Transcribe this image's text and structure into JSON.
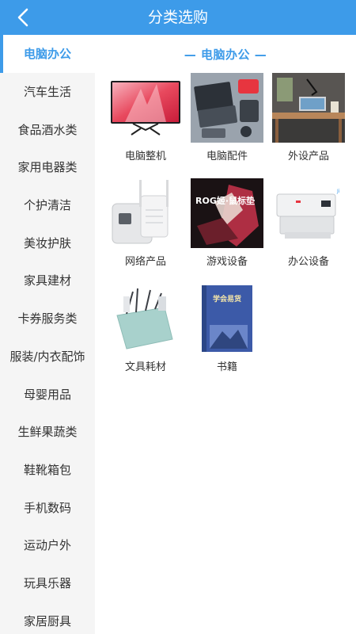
{
  "header": {
    "title": "分类选购",
    "back_icon": "chevron-left-icon"
  },
  "sidebar": {
    "active_index": 0,
    "items": [
      {
        "label": "电脑办公"
      },
      {
        "label": "汽车生活"
      },
      {
        "label": "食品酒水类"
      },
      {
        "label": "家用电器类"
      },
      {
        "label": "个护清洁"
      },
      {
        "label": "美妆护肤"
      },
      {
        "label": "家具建材"
      },
      {
        "label": "卡券服务类"
      },
      {
        "label": "服装/内衣配饰"
      },
      {
        "label": "母婴用品"
      },
      {
        "label": "生鲜果蔬类"
      },
      {
        "label": "鞋靴箱包"
      },
      {
        "label": "手机数码"
      },
      {
        "label": "运动户外"
      },
      {
        "label": "玩具乐器"
      },
      {
        "label": "家居厨具"
      }
    ]
  },
  "content": {
    "section_title": "— 电脑办公 —",
    "categories": [
      {
        "label": "电脑整机",
        "icon": "monitor-image"
      },
      {
        "label": "电脑配件",
        "icon": "laptop-accessories-image"
      },
      {
        "label": "外设产品",
        "icon": "desk-setup-image"
      },
      {
        "label": "网络产品",
        "icon": "wifi-extender-image"
      },
      {
        "label": "游戏设备",
        "icon": "gaming-mousepad-image",
        "image_text": "ROG姬·鼠标垫"
      },
      {
        "label": "办公设备",
        "icon": "printer-image"
      },
      {
        "label": "文具耗材",
        "icon": "desk-organizer-image"
      },
      {
        "label": "书籍",
        "icon": "book-image",
        "image_text": "学会易货"
      }
    ]
  },
  "colors": {
    "accent": "#3d9be9",
    "sidebar_bg": "#f5f5f5",
    "text": "#333333"
  }
}
